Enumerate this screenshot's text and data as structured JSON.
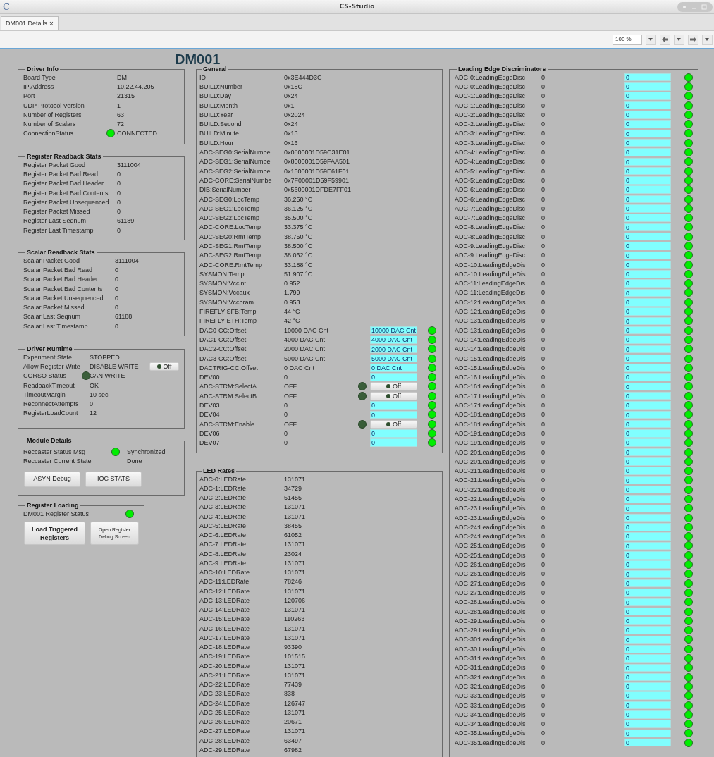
{
  "window": {
    "title": "CS-Studio",
    "logo": "C"
  },
  "tabs": [
    {
      "label": "DM001 Details",
      "close": "×",
      "selected": true
    }
  ],
  "toolbar": {
    "zoom": "100 %"
  },
  "title": "DM001",
  "left_groups": [
    {
      "title": "Driver Info",
      "rows": [
        {
          "label": "Board Type",
          "value": "DM"
        },
        {
          "label": "IP Address",
          "value": "10.22.44.205"
        },
        {
          "label": "Port",
          "value": "21315"
        },
        {
          "label": "UDP Protocol Version",
          "value": "1"
        },
        {
          "label": "Number of Registers",
          "value": "63"
        },
        {
          "label": "Number of Scalars",
          "value": "72"
        },
        {
          "label": "ConnectionStatus",
          "value": "CONNECTED",
          "led": true
        }
      ]
    },
    {
      "title": "Register Readback Stats",
      "rows": [
        {
          "label": "Register Packet Good",
          "value": "3111004"
        },
        {
          "label": "Register Packet Bad Read",
          "value": "0"
        },
        {
          "label": "Register Packet Bad Header",
          "value": "0"
        },
        {
          "label": "Register Packet Bad Contents",
          "value": "0"
        },
        {
          "label": "Register Packet Unsequenced",
          "value": "0"
        },
        {
          "label": "Register Packet Missed",
          "value": "0"
        },
        {
          "label": "Register Last Seqnum",
          "value": "61189"
        },
        {
          "label": "Register Last Timestamp",
          "value": "0"
        }
      ]
    },
    {
      "title": "Scalar Readback Stats",
      "rows": [
        {
          "label": "Scalar Packet Good",
          "value": "3111004"
        },
        {
          "label": "Scalar Packet Bad Read",
          "value": "0"
        },
        {
          "label": "Scalar Packet Bad Header",
          "value": "0"
        },
        {
          "label": "Scalar Packet Bad Contents",
          "value": "0"
        },
        {
          "label": "Scalar Packet Unsequenced",
          "value": "0"
        },
        {
          "label": "Scalar Packet Missed",
          "value": "0"
        },
        {
          "label": "Scalar Last Seqnum",
          "value": "61188"
        },
        {
          "label": "Scalar Last Timestamp",
          "value": "0"
        }
      ]
    },
    {
      "title": "Driver Runtime",
      "rows": [
        {
          "label": "Experiment State",
          "value": "STOPPED"
        },
        {
          "label": "Allow Register Write",
          "value": "DISABLE WRITE",
          "button": {
            "label": "Off",
            "on": false
          }
        },
        {
          "label": "CORSO Status",
          "value": "CAN WRITE",
          "led": false
        },
        {
          "label": "ReadbackTimeout",
          "value": "OK"
        },
        {
          "label": "TimeoutMargin",
          "value": "10 sec"
        },
        {
          "label": "ReconnectAttempts",
          "value": "0"
        },
        {
          "label": "RegisterLoadCount",
          "value": "12"
        }
      ]
    },
    {
      "title": "Module Details",
      "rows": [
        {
          "label": "Reccaster Status Msg",
          "value": "Synchronized",
          "led": true
        },
        {
          "label": "Reccaster Current State",
          "value": "Done"
        }
      ],
      "buttons": [
        {
          "label": "ASYN Debug",
          "kind": "normal"
        },
        {
          "label": "IOC STATS",
          "kind": "normal"
        }
      ]
    },
    {
      "title": "Register Loading",
      "rows": [
        {
          "label": "DM001 Register Status",
          "led": true
        }
      ],
      "buttons": [
        {
          "label": "Load Triggered Registers",
          "kind": "bold"
        },
        {
          "label": "Open Register Debug Screen",
          "kind": "small"
        }
      ]
    }
  ],
  "general": {
    "title": "General",
    "rows": [
      {
        "kind": "readout",
        "label": "ID",
        "value": "0x3E444D3C"
      },
      {
        "kind": "readout",
        "label": "BUILD:Number",
        "value": "0x18C"
      },
      {
        "kind": "readout",
        "label": "BUILD:Day",
        "value": "0x24"
      },
      {
        "kind": "readout",
        "label": "BUILD:Month",
        "value": "0x1"
      },
      {
        "kind": "readout",
        "label": "BUILD:Year",
        "value": "0x2024"
      },
      {
        "kind": "readout",
        "label": "BUILD:Second",
        "value": "0x24"
      },
      {
        "kind": "readout",
        "label": "BUILD:Minute",
        "value": "0x13"
      },
      {
        "kind": "readout",
        "label": "BUILD:Hour",
        "value": "0x16"
      },
      {
        "kind": "readout",
        "label": "ADC-SEG0:SerialNumbe",
        "value": "0x0800001D59C31E01"
      },
      {
        "kind": "readout",
        "label": "ADC-SEG1:SerialNumbe",
        "value": "0x8000001D59FAA501"
      },
      {
        "kind": "readout",
        "label": "ADC-SEG2:SerialNumbe",
        "value": "0x1500001D59E61F01"
      },
      {
        "kind": "readout",
        "label": "ADC-CORE:SerialNumbe",
        "value": "0x7F00001D59F59901"
      },
      {
        "kind": "readout",
        "label": "DIB:SerialNumber",
        "value": "0x5600001DFDE7FF01"
      },
      {
        "kind": "readout",
        "label": "ADC-SEG0:LocTemp",
        "value": "36.250 °C"
      },
      {
        "kind": "readout",
        "label": "ADC-SEG1:LocTemp",
        "value": "36.125 °C"
      },
      {
        "kind": "readout",
        "label": "ADC-SEG2:LocTemp",
        "value": "35.500 °C"
      },
      {
        "kind": "readout",
        "label": "ADC-CORE:LocTemp",
        "value": "33.375 °C"
      },
      {
        "kind": "readout",
        "label": "ADC-SEG0:RmtTemp",
        "value": "38.750 °C"
      },
      {
        "kind": "readout",
        "label": "ADC-SEG1:RmtTemp",
        "value": "38.500 °C"
      },
      {
        "kind": "readout",
        "label": "ADC-SEG2:RmtTemp",
        "value": "38.062 °C"
      },
      {
        "kind": "readout",
        "label": "ADC-CORE:RmtTemp",
        "value": "33.188 °C"
      },
      {
        "kind": "readout",
        "label": "SYSMON:Temp",
        "value": "51.907 °C"
      },
      {
        "kind": "readout",
        "label": "SYSMON:Vccint",
        "value": "0.952"
      },
      {
        "kind": "readout",
        "label": "SYSMON:Vccaux",
        "value": "1.799"
      },
      {
        "kind": "readout",
        "label": "SYSMON:Vccbram",
        "value": "0.953"
      },
      {
        "kind": "readout",
        "label": "FIREFLY-SFB:Temp",
        "value": "44 °C"
      },
      {
        "kind": "readout",
        "label": "FIREFLY-ETH:Temp",
        "value": "42 °C"
      },
      {
        "kind": "setpoint",
        "label": "DAC0-CC:Offset",
        "value": "10000 DAC Cnt",
        "input": "10000 DAC Cnt",
        "ok": true
      },
      {
        "kind": "setpoint",
        "label": "DAC1-CC:Offset",
        "value": "4000 DAC Cnt",
        "input": "4000 DAC Cnt",
        "ok": true
      },
      {
        "kind": "setpoint",
        "label": "DAC2-CC:Offset",
        "value": "2000 DAC Cnt",
        "input": "2000 DAC Cnt",
        "ok": true
      },
      {
        "kind": "setpoint",
        "label": "DAC3-CC:Offset",
        "value": "5000 DAC Cnt",
        "input": "5000 DAC Cnt",
        "ok": true
      },
      {
        "kind": "setpoint",
        "label": "DACTRIG-CC:Offset",
        "value": "0 DAC Cnt",
        "input": "0 DAC Cnt",
        "ok": true
      },
      {
        "kind": "setpoint",
        "label": "DEV00",
        "value": "0",
        "input": "0",
        "ok": true
      },
      {
        "kind": "toggle",
        "label": "ADC-STRM:SelectA",
        "value": "OFF",
        "led": false,
        "button": {
          "label": "Off",
          "on": false
        },
        "ok": true
      },
      {
        "kind": "toggle",
        "label": "ADC-STRM:SelectB",
        "value": "OFF",
        "led": false,
        "button": {
          "label": "Off",
          "on": false
        },
        "ok": true
      },
      {
        "kind": "setpoint",
        "label": "DEV03",
        "value": "0",
        "input": "0",
        "ok": true
      },
      {
        "kind": "setpoint",
        "label": "DEV04",
        "value": "0",
        "input": "0",
        "ok": true
      },
      {
        "kind": "toggle",
        "label": "ADC-STRM:Enable",
        "value": "OFF",
        "led": false,
        "button": {
          "label": "Off",
          "on": false
        },
        "ok": true
      },
      {
        "kind": "setpoint",
        "label": "DEV06",
        "value": "0",
        "input": "0",
        "ok": true
      },
      {
        "kind": "setpoint",
        "label": "DEV07",
        "value": "0",
        "input": "0",
        "ok": true
      }
    ]
  },
  "led_rates": {
    "title": "LED Rates",
    "rows": [
      {
        "label": "ADC-0:LEDRate",
        "value": "131071"
      },
      {
        "label": "ADC-1:LEDRate",
        "value": "34729"
      },
      {
        "label": "ADC-2:LEDRate",
        "value": "51455"
      },
      {
        "label": "ADC-3:LEDRate",
        "value": "131071"
      },
      {
        "label": "ADC-4:LEDRate",
        "value": "131071"
      },
      {
        "label": "ADC-5:LEDRate",
        "value": "38455"
      },
      {
        "label": "ADC-6:LEDRate",
        "value": "61052"
      },
      {
        "label": "ADC-7:LEDRate",
        "value": "131071"
      },
      {
        "label": "ADC-8:LEDRate",
        "value": "23024"
      },
      {
        "label": "ADC-9:LEDRate",
        "value": "131071"
      },
      {
        "label": "ADC-10:LEDRate",
        "value": "131071"
      },
      {
        "label": "ADC-11:LEDRate",
        "value": "78246"
      },
      {
        "label": "ADC-12:LEDRate",
        "value": "131071"
      },
      {
        "label": "ADC-13:LEDRate",
        "value": "120706"
      },
      {
        "label": "ADC-14:LEDRate",
        "value": "131071"
      },
      {
        "label": "ADC-15:LEDRate",
        "value": "110263"
      },
      {
        "label": "ADC-16:LEDRate",
        "value": "131071"
      },
      {
        "label": "ADC-17:LEDRate",
        "value": "131071"
      },
      {
        "label": "ADC-18:LEDRate",
        "value": "93390"
      },
      {
        "label": "ADC-19:LEDRate",
        "value": "101515"
      },
      {
        "label": "ADC-20:LEDRate",
        "value": "131071"
      },
      {
        "label": "ADC-21:LEDRate",
        "value": "131071"
      },
      {
        "label": "ADC-22:LEDRate",
        "value": "77439"
      },
      {
        "label": "ADC-23:LEDRate",
        "value": "838"
      },
      {
        "label": "ADC-24:LEDRate",
        "value": "126747"
      },
      {
        "label": "ADC-25:LEDRate",
        "value": "131071"
      },
      {
        "label": "ADC-26:LEDRate",
        "value": "20671"
      },
      {
        "label": "ADC-27:LEDRate",
        "value": "131071"
      },
      {
        "label": "ADC-28:LEDRate",
        "value": "63497"
      },
      {
        "label": "ADC-29:LEDRate",
        "value": "67982"
      }
    ]
  },
  "discriminators": {
    "title": "Leading Edge Discriminators",
    "rows": [
      {
        "label": "ADC-0:LeadingEdgeDisc",
        "value": "0",
        "input": "0",
        "ok": true
      },
      {
        "label": "ADC-0:LeadingEdgeDisc",
        "value": "0",
        "input": "0",
        "ok": true
      },
      {
        "label": "ADC-1:LeadingEdgeDisc",
        "value": "0",
        "input": "0",
        "ok": true
      },
      {
        "label": "ADC-1:LeadingEdgeDisc",
        "value": "0",
        "input": "0",
        "ok": true
      },
      {
        "label": "ADC-2:LeadingEdgeDisc",
        "value": "0",
        "input": "0",
        "ok": true
      },
      {
        "label": "ADC-2:LeadingEdgeDisc",
        "value": "0",
        "input": "0",
        "ok": true
      },
      {
        "label": "ADC-3:LeadingEdgeDisc",
        "value": "0",
        "input": "0",
        "ok": true
      },
      {
        "label": "ADC-3:LeadingEdgeDisc",
        "value": "0",
        "input": "0",
        "ok": true
      },
      {
        "label": "ADC-4:LeadingEdgeDisc",
        "value": "0",
        "input": "0",
        "ok": true
      },
      {
        "label": "ADC-4:LeadingEdgeDisc",
        "value": "0",
        "input": "0",
        "ok": true
      },
      {
        "label": "ADC-5:LeadingEdgeDisc",
        "value": "0",
        "input": "0",
        "ok": true
      },
      {
        "label": "ADC-5:LeadingEdgeDisc",
        "value": "0",
        "input": "0",
        "ok": true
      },
      {
        "label": "ADC-6:LeadingEdgeDisc",
        "value": "0",
        "input": "0",
        "ok": true
      },
      {
        "label": "ADC-6:LeadingEdgeDisc",
        "value": "0",
        "input": "0",
        "ok": true
      },
      {
        "label": "ADC-7:LeadingEdgeDisc",
        "value": "0",
        "input": "0",
        "ok": true
      },
      {
        "label": "ADC-7:LeadingEdgeDisc",
        "value": "0",
        "input": "0",
        "ok": true
      },
      {
        "label": "ADC-8:LeadingEdgeDisc",
        "value": "0",
        "input": "0",
        "ok": true
      },
      {
        "label": "ADC-8:LeadingEdgeDisc",
        "value": "0",
        "input": "0",
        "ok": true
      },
      {
        "label": "ADC-9:LeadingEdgeDisc",
        "value": "0",
        "input": "0",
        "ok": true
      },
      {
        "label": "ADC-9:LeadingEdgeDisc",
        "value": "0",
        "input": "0",
        "ok": true
      },
      {
        "label": "ADC-10:LeadingEdgeDis",
        "value": "0",
        "input": "0",
        "ok": true
      },
      {
        "label": "ADC-10:LeadingEdgeDis",
        "value": "0",
        "input": "0",
        "ok": true
      },
      {
        "label": "ADC-11:LeadingEdgeDis",
        "value": "0",
        "input": "0",
        "ok": true
      },
      {
        "label": "ADC-11:LeadingEdgeDis",
        "value": "0",
        "input": "0",
        "ok": true
      },
      {
        "label": "ADC-12:LeadingEdgeDis",
        "value": "0",
        "input": "0",
        "ok": true
      },
      {
        "label": "ADC-12:LeadingEdgeDis",
        "value": "0",
        "input": "0",
        "ok": true
      },
      {
        "label": "ADC-13:LeadingEdgeDis",
        "value": "0",
        "input": "0",
        "ok": true
      },
      {
        "label": "ADC-13:LeadingEdgeDis",
        "value": "0",
        "input": "0",
        "ok": true
      },
      {
        "label": "ADC-14:LeadingEdgeDis",
        "value": "0",
        "input": "0",
        "ok": true
      },
      {
        "label": "ADC-14:LeadingEdgeDis",
        "value": "0",
        "input": "0",
        "ok": true
      },
      {
        "label": "ADC-15:LeadingEdgeDis",
        "value": "0",
        "input": "0",
        "ok": true
      },
      {
        "label": "ADC-15:LeadingEdgeDis",
        "value": "0",
        "input": "0",
        "ok": true
      },
      {
        "label": "ADC-16:LeadingEdgeDis",
        "value": "0",
        "input": "0",
        "ok": true
      },
      {
        "label": "ADC-16:LeadingEdgeDis",
        "value": "0",
        "input": "0",
        "ok": true
      },
      {
        "label": "ADC-17:LeadingEdgeDis",
        "value": "0",
        "input": "0",
        "ok": true
      },
      {
        "label": "ADC-17:LeadingEdgeDis",
        "value": "0",
        "input": "0",
        "ok": true
      },
      {
        "label": "ADC-18:LeadingEdgeDis",
        "value": "0",
        "input": "0",
        "ok": true
      },
      {
        "label": "ADC-18:LeadingEdgeDis",
        "value": "0",
        "input": "0",
        "ok": true
      },
      {
        "label": "ADC-19:LeadingEdgeDis",
        "value": "0",
        "input": "0",
        "ok": true
      },
      {
        "label": "ADC-19:LeadingEdgeDis",
        "value": "0",
        "input": "0",
        "ok": true
      },
      {
        "label": "ADC-20:LeadingEdgeDis",
        "value": "0",
        "input": "0",
        "ok": true
      },
      {
        "label": "ADC-20:LeadingEdgeDis",
        "value": "0",
        "input": "0",
        "ok": true
      },
      {
        "label": "ADC-21:LeadingEdgeDis",
        "value": "0",
        "input": "0",
        "ok": true
      },
      {
        "label": "ADC-21:LeadingEdgeDis",
        "value": "0",
        "input": "0",
        "ok": true
      },
      {
        "label": "ADC-22:LeadingEdgeDis",
        "value": "0",
        "input": "0",
        "ok": true
      },
      {
        "label": "ADC-22:LeadingEdgeDis",
        "value": "0",
        "input": "0",
        "ok": true
      },
      {
        "label": "ADC-23:LeadingEdgeDis",
        "value": "0",
        "input": "0",
        "ok": true
      },
      {
        "label": "ADC-23:LeadingEdgeDis",
        "value": "0",
        "input": "0",
        "ok": true
      },
      {
        "label": "ADC-24:LeadingEdgeDis",
        "value": "0",
        "input": "0",
        "ok": true
      },
      {
        "label": "ADC-24:LeadingEdgeDis",
        "value": "0",
        "input": "0",
        "ok": true
      },
      {
        "label": "ADC-25:LeadingEdgeDis",
        "value": "0",
        "input": "0",
        "ok": true
      },
      {
        "label": "ADC-25:LeadingEdgeDis",
        "value": "0",
        "input": "0",
        "ok": true
      },
      {
        "label": "ADC-26:LeadingEdgeDis",
        "value": "0",
        "input": "0",
        "ok": true
      },
      {
        "label": "ADC-26:LeadingEdgeDis",
        "value": "0",
        "input": "0",
        "ok": true
      },
      {
        "label": "ADC-27:LeadingEdgeDis",
        "value": "0",
        "input": "0",
        "ok": true
      },
      {
        "label": "ADC-27:LeadingEdgeDis",
        "value": "0",
        "input": "0",
        "ok": true
      },
      {
        "label": "ADC-28:LeadingEdgeDis",
        "value": "0",
        "input": "0",
        "ok": true
      },
      {
        "label": "ADC-28:LeadingEdgeDis",
        "value": "0",
        "input": "0",
        "ok": true
      },
      {
        "label": "ADC-29:LeadingEdgeDis",
        "value": "0",
        "input": "0",
        "ok": true
      },
      {
        "label": "ADC-29:LeadingEdgeDis",
        "value": "0",
        "input": "0",
        "ok": true
      },
      {
        "label": "ADC-30:LeadingEdgeDis",
        "value": "0",
        "input": "0",
        "ok": true
      },
      {
        "label": "ADC-30:LeadingEdgeDis",
        "value": "0",
        "input": "0",
        "ok": true
      },
      {
        "label": "ADC-31:LeadingEdgeDis",
        "value": "0",
        "input": "0",
        "ok": true
      },
      {
        "label": "ADC-31:LeadingEdgeDis",
        "value": "0",
        "input": "0",
        "ok": true
      },
      {
        "label": "ADC-32:LeadingEdgeDis",
        "value": "0",
        "input": "0",
        "ok": true
      },
      {
        "label": "ADC-32:LeadingEdgeDis",
        "value": "0",
        "input": "0",
        "ok": true
      },
      {
        "label": "ADC-33:LeadingEdgeDis",
        "value": "0",
        "input": "0",
        "ok": true
      },
      {
        "label": "ADC-33:LeadingEdgeDis",
        "value": "0",
        "input": "0",
        "ok": true
      },
      {
        "label": "ADC-34:LeadingEdgeDis",
        "value": "0",
        "input": "0",
        "ok": true
      },
      {
        "label": "ADC-34:LeadingEdgeDis",
        "value": "0",
        "input": "0",
        "ok": true
      },
      {
        "label": "ADC-35:LeadingEdgeDis",
        "value": "0",
        "input": "0",
        "ok": true
      },
      {
        "label": "ADC-35:LeadingEdgeDis",
        "value": "0",
        "input": "0",
        "ok": true
      }
    ]
  }
}
